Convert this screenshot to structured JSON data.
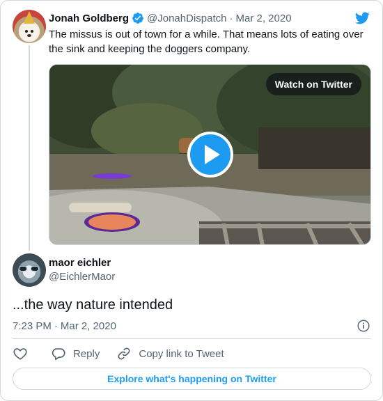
{
  "colors": {
    "accent": "#1d9bf0",
    "text": "#0f1419",
    "secondary_text": "#536471",
    "border": "#cfd9de"
  },
  "parent_tweet": {
    "author_name": "Jonah Goldberg",
    "verified_icon": "verified-badge-icon",
    "handle": "@JonahDispatch",
    "separator": "·",
    "date": "Mar 2, 2020",
    "text": "The missus is out of town for a while. That means lots of eating over the sink and keeping the doggers company.",
    "media": {
      "watch_label": "Watch on Twitter",
      "play_icon": "play-icon"
    }
  },
  "brand_icon": "twitter-bird-icon",
  "reply_tweet": {
    "author_name": "maor eichler",
    "handle": "@EichlerMaor",
    "text": "...the way nature intended",
    "time": "7:23 PM",
    "separator": "·",
    "date": "Mar 2, 2020",
    "info_icon": "info-icon"
  },
  "actions": {
    "like_icon": "heart-icon",
    "reply_icon": "reply-bubble-icon",
    "reply_label": "Reply",
    "copy_icon": "link-icon",
    "copy_label": "Copy link to Tweet"
  },
  "footer": {
    "explore_label": "Explore what's happening on Twitter"
  }
}
